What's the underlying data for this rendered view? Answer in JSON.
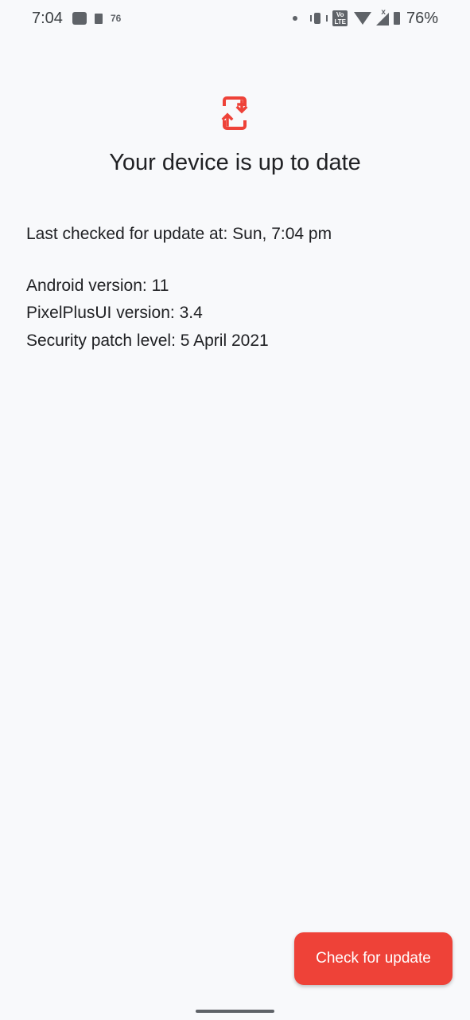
{
  "status_bar": {
    "time": "7:04",
    "notification_count": "76",
    "battery_percent": "76%",
    "network_label": "Vo LTE",
    "icons": [
      "message-icon",
      "trash-icon",
      "dot-icon",
      "vibrate-icon",
      "volte-icon",
      "wifi-icon",
      "signal-icon",
      "battery-icon"
    ]
  },
  "main": {
    "icon": "system-update-icon",
    "title": "Your device is up to date",
    "last_checked": "Last checked for update at: Sun, 7:04 pm",
    "android_version": "Android version: 11",
    "rom_version": "PixelPlusUI version: 3.4",
    "security_patch": "Security patch level: 5 April 2021"
  },
  "actions": {
    "check_button_label": "Check for update"
  },
  "colors": {
    "accent": "#ee4238",
    "background": "#f8f9fb",
    "text": "#202124"
  }
}
